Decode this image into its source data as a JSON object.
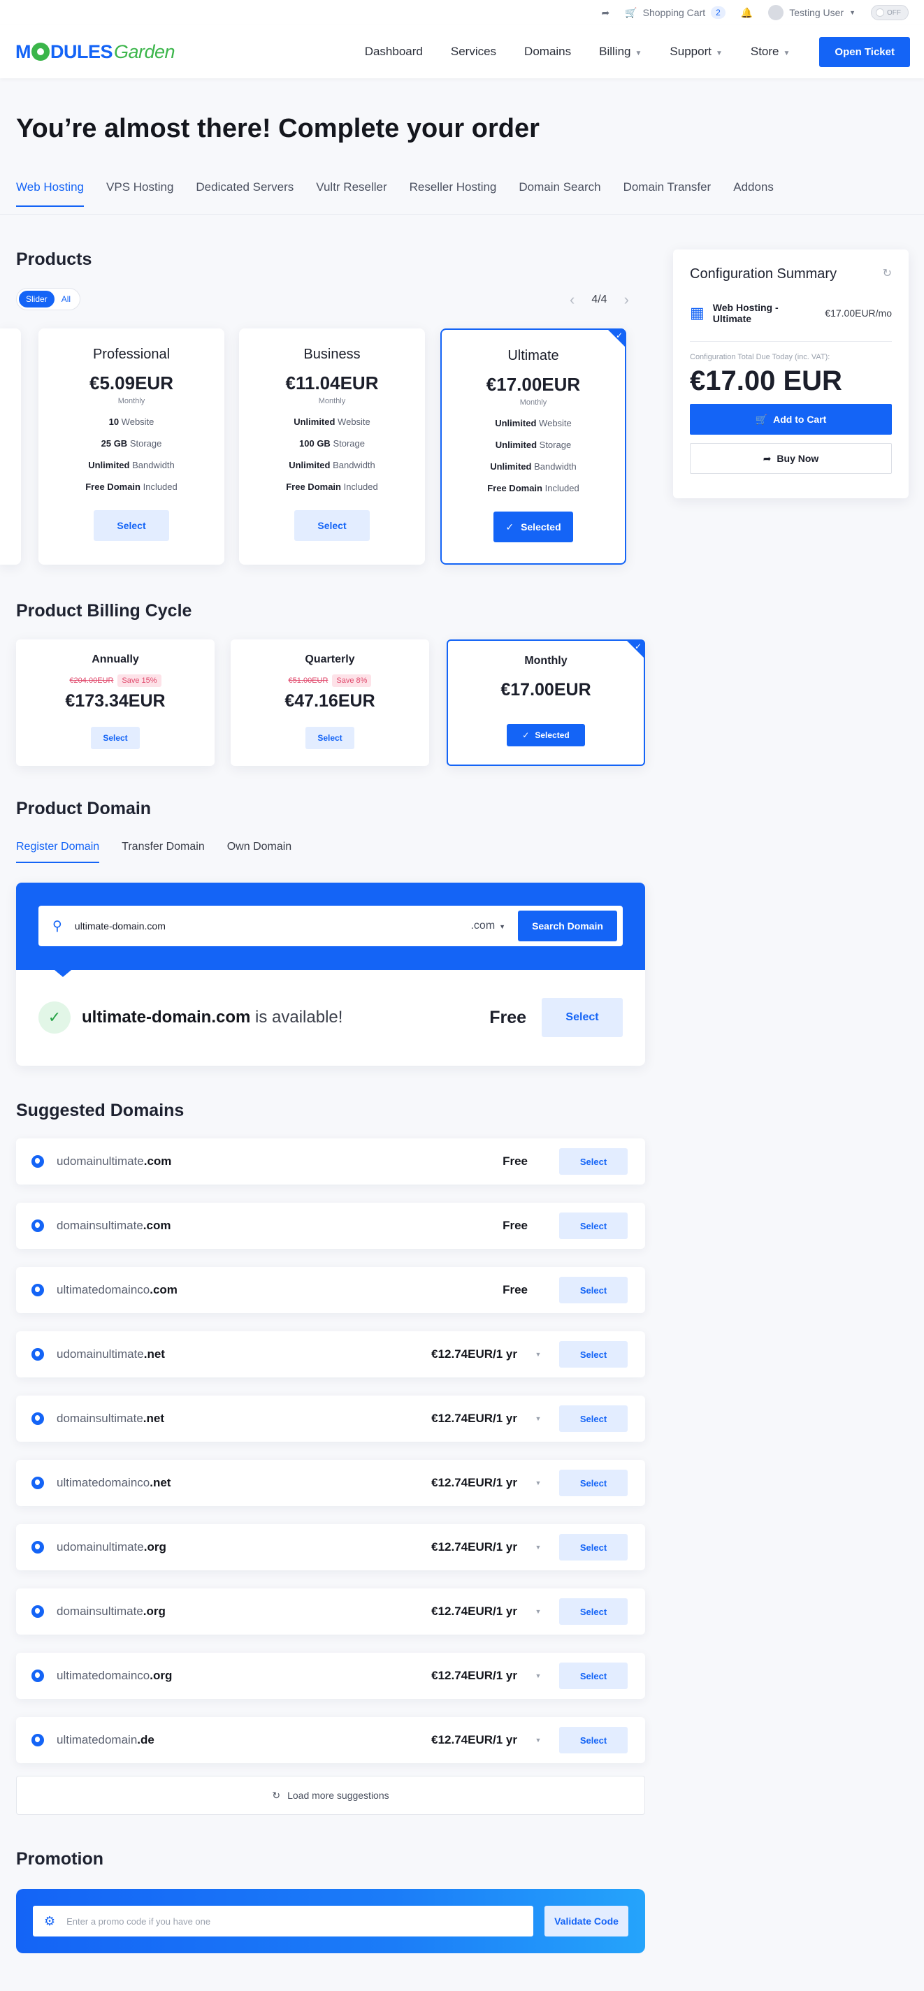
{
  "utilbar": {
    "cart_label": "Shopping Cart",
    "cart_count": "2",
    "user_name": "Testing User",
    "toggle_label": "OFF"
  },
  "nav": {
    "logo_left": "M",
    "logo_mid": "DULES",
    "logo_right": "Garden",
    "links": [
      "Dashboard",
      "Services",
      "Domains",
      "Billing",
      "Support",
      "Store"
    ],
    "open_ticket": "Open Ticket"
  },
  "page_title": "You’re almost there! Complete your order",
  "category_tabs": [
    "Web Hosting",
    "VPS Hosting",
    "Dedicated Servers",
    "Vultr Reseller",
    "Reseller Hosting",
    "Domain Search",
    "Domain Transfer",
    "Addons"
  ],
  "products": {
    "heading": "Products",
    "view_toggle": [
      "Slider",
      "All"
    ],
    "pager": "4/4",
    "cards": [
      {
        "name": "Professional",
        "price": "€5.09EUR",
        "period": "Monthly",
        "f1b": "10",
        "f1": " Website",
        "f2b": "25 GB",
        "f2": " Storage",
        "f3b": "Unlimited",
        "f3": " Bandwidth",
        "f4b": "Free Domain",
        "f4": " Included",
        "button": "Select"
      },
      {
        "name": "Business",
        "price": "€11.04EUR",
        "period": "Monthly",
        "f1b": "Unlimited",
        "f1": " Website",
        "f2b": "100 GB",
        "f2": " Storage",
        "f3b": "Unlimited",
        "f3": " Bandwidth",
        "f4b": "Free Domain",
        "f4": " Included",
        "button": "Select"
      },
      {
        "name": "Ultimate",
        "price": "€17.00EUR",
        "period": "Monthly",
        "f1b": "Unlimited",
        "f1": " Website",
        "f2b": "Unlimited",
        "f2": " Storage",
        "f3b": "Unlimited",
        "f3": " Bandwidth",
        "f4b": "Free Domain",
        "f4": " Included",
        "button": "Selected"
      }
    ]
  },
  "summary": {
    "title": "Configuration Summary",
    "item_name": "Web Hosting - Ultimate",
    "item_price": "€17.00EUR/mo",
    "due_label": "Configuration Total Due Today (inc. VAT):",
    "due_total": "€17.00 EUR",
    "add_to_cart": "Add to Cart",
    "buy_now": "Buy Now"
  },
  "billing": {
    "heading": "Product Billing Cycle",
    "cycles": [
      {
        "name": "Annually",
        "old_price": "€204.00EUR",
        "save": "Save 15%",
        "price": "€173.34EUR",
        "button": "Select"
      },
      {
        "name": "Quarterly",
        "old_price": "€51.00EUR",
        "save": "Save 8%",
        "price": "€47.16EUR",
        "button": "Select"
      },
      {
        "name": "Monthly",
        "price": "€17.00EUR",
        "button": "Selected"
      }
    ]
  },
  "domain": {
    "heading": "Product Domain",
    "tabs": [
      "Register Domain",
      "Transfer Domain",
      "Own Domain"
    ],
    "search_value": "ultimate-domain.com",
    "tld": ".com",
    "search_button": "Search Domain",
    "result_domain": "ultimate-domain.com",
    "result_suffix": " is available!",
    "result_price": "Free",
    "result_button": "Select"
  },
  "suggested": {
    "heading": "Suggested Domains",
    "rows": [
      {
        "sld": "udomainultimate",
        "tld": ".com",
        "price": "Free",
        "button": "Select"
      },
      {
        "sld": "domainsultimate",
        "tld": ".com",
        "price": "Free",
        "button": "Select"
      },
      {
        "sld": "ultimatedomainco",
        "tld": ".com",
        "price": "Free",
        "button": "Select"
      },
      {
        "sld": "udomainultimate",
        "tld": ".net",
        "price": "€12.74EUR/1 yr",
        "button": "Select"
      },
      {
        "sld": "domainsultimate",
        "tld": ".net",
        "price": "€12.74EUR/1 yr",
        "button": "Select"
      },
      {
        "sld": "ultimatedomainco",
        "tld": ".net",
        "price": "€12.74EUR/1 yr",
        "button": "Select"
      },
      {
        "sld": "udomainultimate",
        "tld": ".org",
        "price": "€12.74EUR/1 yr",
        "button": "Select"
      },
      {
        "sld": "domainsultimate",
        "tld": ".org",
        "price": "€12.74EUR/1 yr",
        "button": "Select"
      },
      {
        "sld": "ultimatedomainco",
        "tld": ".org",
        "price": "€12.74EUR/1 yr",
        "button": "Select"
      },
      {
        "sld": "ultimatedomain",
        "tld": ".de",
        "price": "€12.74EUR/1 yr",
        "button": "Select"
      }
    ],
    "load_more": "Load more suggestions"
  },
  "promotion": {
    "heading": "Promotion",
    "placeholder": "Enter a promo code if you have one",
    "button": "Validate Code"
  },
  "colors": {
    "accent": "#1464f6",
    "accent_light": "#e3edff",
    "success": "#27a347",
    "discount": "#e0486b"
  },
  "icons": [
    "share-icon",
    "cart-icon",
    "bell-icon",
    "refresh-icon",
    "box-icon",
    "cart-add-icon",
    "share-arrow-icon",
    "search-icon",
    "check-icon",
    "globe-icon",
    "gear-icon"
  ]
}
